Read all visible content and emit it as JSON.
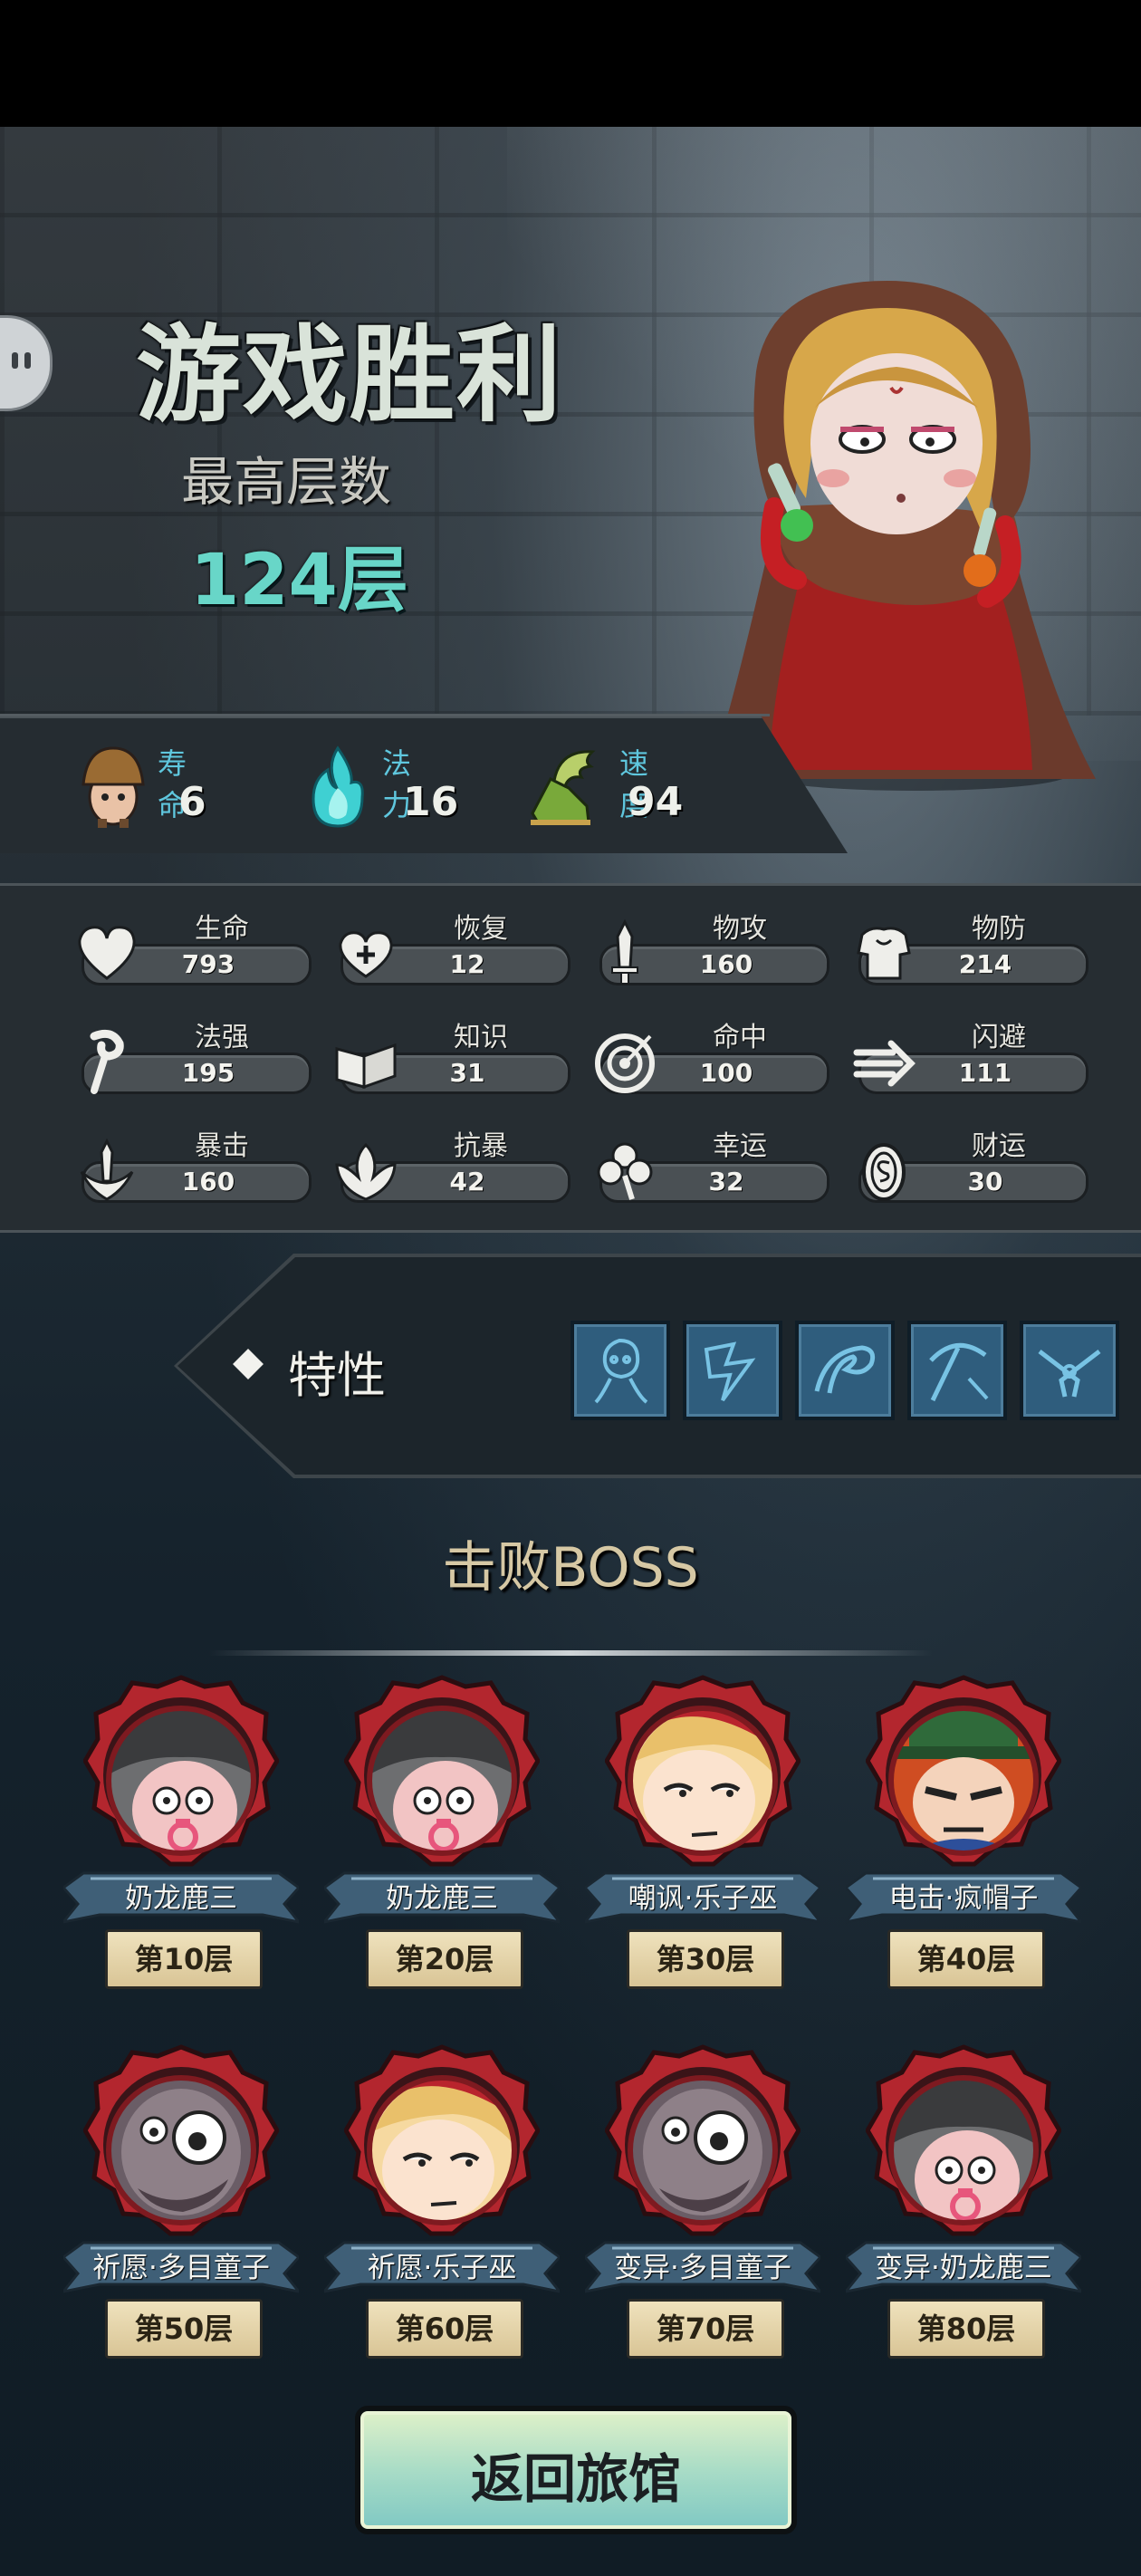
{
  "header": {
    "title": "游戏胜利",
    "subtitle": "最高层数",
    "floors": "124层"
  },
  "top_stats": [
    {
      "label": "寿命",
      "value": "6",
      "icon": "mushroom-head-icon"
    },
    {
      "label": "法力",
      "value": "16",
      "icon": "blue-flame-icon"
    },
    {
      "label": "速度",
      "value": "94",
      "icon": "winged-boot-icon"
    }
  ],
  "stats": [
    {
      "label": "生命",
      "value": "793",
      "icon": "heart-icon"
    },
    {
      "label": "恢复",
      "value": "12",
      "icon": "heal-heart-icon"
    },
    {
      "label": "物攻",
      "value": "160",
      "icon": "sword-icon"
    },
    {
      "label": "物防",
      "value": "214",
      "icon": "armor-icon"
    },
    {
      "label": "法强",
      "value": "195",
      "icon": "staff-icon"
    },
    {
      "label": "知识",
      "value": "31",
      "icon": "book-icon"
    },
    {
      "label": "命中",
      "value": "100",
      "icon": "target-icon"
    },
    {
      "label": "闪避",
      "value": "111",
      "icon": "dash-arrow-icon"
    },
    {
      "label": "暴击",
      "value": "160",
      "icon": "crit-sword-icon"
    },
    {
      "label": "抗暴",
      "value": "42",
      "icon": "shield-flower-icon"
    },
    {
      "label": "幸运",
      "value": "32",
      "icon": "clover-icon"
    },
    {
      "label": "财运",
      "value": "30",
      "icon": "coin-icon"
    }
  ],
  "traits": {
    "label": "特性",
    "icons": [
      "spirit-trait-icon",
      "lightning-trait-icon",
      "swirl-trait-icon",
      "pickaxe-trait-icon",
      "dual-pistol-trait-icon"
    ]
  },
  "boss_section": {
    "title": "击败BOSS",
    "bosses": [
      {
        "name": "奶龙鹿三",
        "floor": "第10层",
        "portrait": "helmet-baby-portrait"
      },
      {
        "name": "奶龙鹿三",
        "floor": "第20层",
        "portrait": "helmet-baby-portrait"
      },
      {
        "name": "嘲讽·乐子巫",
        "floor": "第30层",
        "portrait": "blonde-witch-portrait"
      },
      {
        "name": "电击·疯帽子",
        "floor": "第40层",
        "portrait": "mad-hatter-portrait"
      },
      {
        "name": "祈愿·多目童子",
        "floor": "第50层",
        "portrait": "many-eyed-child-portrait"
      },
      {
        "name": "祈愿·乐子巫",
        "floor": "第60层",
        "portrait": "blonde-witch-portrait"
      },
      {
        "name": "变异·多目童子",
        "floor": "第70层",
        "portrait": "many-eyed-child-portrait"
      },
      {
        "name": "变异·奶龙鹿三",
        "floor": "第80层",
        "portrait": "helmet-baby-portrait"
      }
    ]
  },
  "footer": {
    "return_label": "返回旅馆"
  },
  "colors": {
    "accent_teal": "#68d6c8",
    "stat_label_blue": "#5fc7de",
    "boss_medal_red": "#b3262e",
    "trait_slot_blue": "#2f5d7d"
  }
}
